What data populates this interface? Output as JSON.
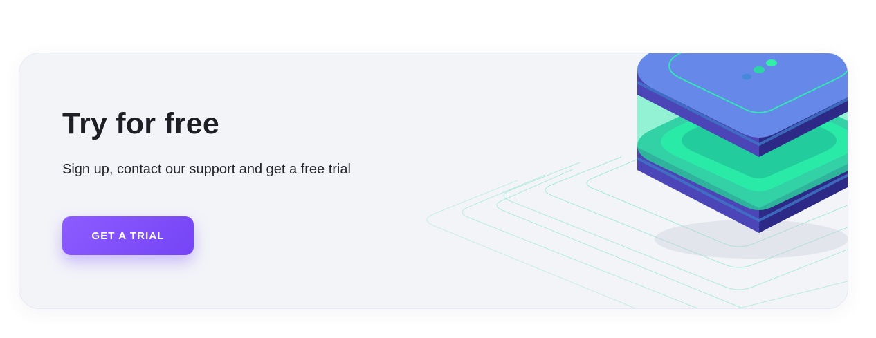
{
  "banner": {
    "title": "Try for free",
    "subtitle": "Sign up, contact our support and get a free trial",
    "cta_label": "GET A TRIAL"
  },
  "illustration": {
    "icon": "server-stack-icon"
  },
  "colors": {
    "card_background": "#f3f4f8",
    "title_text": "#1e1f24",
    "button_primary": "#7c4dff",
    "server_top": "#6688e8",
    "server_side": "#4b45b8",
    "accent_green": "#1de59d",
    "line_accent": "#69e3bf"
  }
}
